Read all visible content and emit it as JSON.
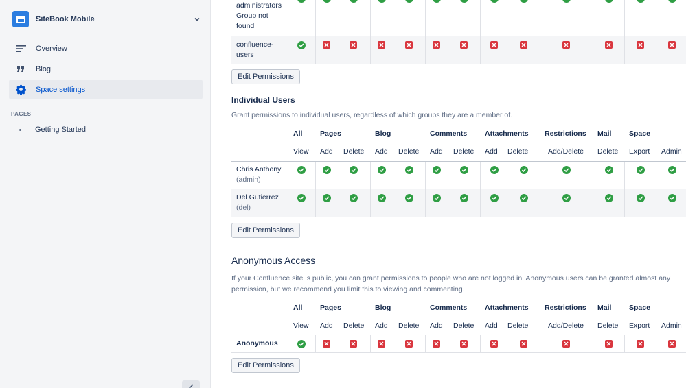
{
  "sidebar": {
    "space_name": "SiteBook Mobile",
    "nav": [
      {
        "label": "Overview",
        "icon": "list-icon"
      },
      {
        "label": "Blog",
        "icon": "quote-icon"
      },
      {
        "label": "Space settings",
        "icon": "gear-icon",
        "active": true
      }
    ],
    "pages_title": "PAGES",
    "pages": [
      "Getting Started"
    ]
  },
  "groups_table": {
    "rows": [
      {
        "name": [
          "administrators",
          "Group not",
          "found"
        ]
      },
      {
        "name": [
          "confluence-",
          "users"
        ]
      }
    ],
    "edit_label": "Edit Permissions"
  },
  "columns": {
    "groups": [
      "All",
      "Pages",
      "Blog",
      "Comments",
      "Attachments",
      "Restrictions",
      "Mail",
      "Space"
    ],
    "subs": [
      "View",
      "Add",
      "Delete",
      "Add",
      "Delete",
      "Add",
      "Delete",
      "Add",
      "Delete",
      "Add/Delete",
      "Delete",
      "Export",
      "Admin"
    ]
  },
  "individual": {
    "title": "Individual Users",
    "description": "Grant permissions to individual users, regardless of which groups they are a member of.",
    "rows": [
      {
        "name": "Chris Anthony",
        "username": "(admin)",
        "perms": "all-granted"
      },
      {
        "name": "Del Gutierrez",
        "username": "(del)",
        "perms": "all-granted"
      }
    ],
    "edit_label": "Edit Permissions"
  },
  "anonymous": {
    "title": "Anonymous Access",
    "description_line1": "If your Confluence site is public, you can grant permissions to people who are not logged in. Anonymous users can be granted almost any",
    "description_line2": "permission, but we recommend you limit this to viewing and commenting.",
    "row_label": "Anonymous",
    "perms": "view-only",
    "edit_label": "Edit Permissions"
  },
  "colors": {
    "granted": "#2f9e44",
    "denied": "#d9363e",
    "link": "#0052cc"
  }
}
